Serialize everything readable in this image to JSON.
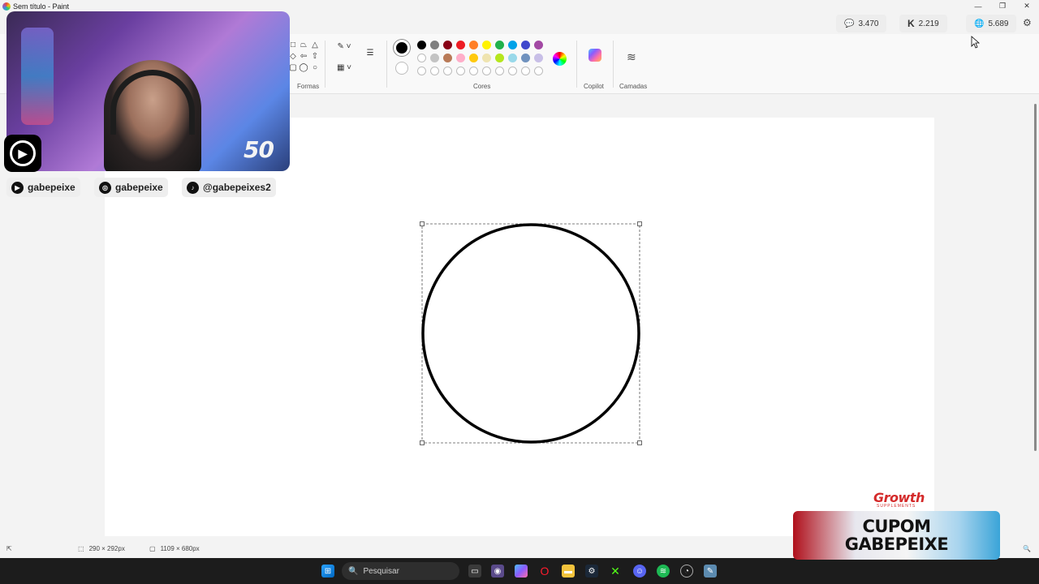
{
  "window": {
    "title": "Sem título - Paint"
  },
  "window_controls": {
    "minimize": "—",
    "maximize": "❐",
    "close": "✕"
  },
  "stats": [
    {
      "icon": "chat-icon",
      "value": "3.470"
    },
    {
      "icon": "kick-icon",
      "value": "2.219"
    },
    {
      "icon": "globe-icon",
      "value": "5.689"
    }
  ],
  "ribbon": {
    "shapes_label": "Formas",
    "colors_label": "Cores",
    "copilot_label": "Copilot",
    "layers_label": "Camadas",
    "palette_row1": [
      "#000000",
      "#7f7f7f",
      "#880015",
      "#ed1c24",
      "#ff7f27",
      "#fff200",
      "#22b14c",
      "#00a2e8",
      "#3f48cc",
      "#a349a4"
    ],
    "palette_row2": [
      "#ffffff",
      "#c3c3c3",
      "#b97a57",
      "#ffaec9",
      "#ffc90e",
      "#efe4b0",
      "#b5e61d",
      "#99d9ea",
      "#7092be",
      "#c8bfe7"
    ]
  },
  "statusbar": {
    "selection_size": "290 × 292px",
    "canvas_size": "1109 × 680px"
  },
  "taskbar": {
    "search_placeholder": "Pesquisar"
  },
  "overlay": {
    "viewer_counter": "50",
    "socials": [
      {
        "icon": "youtube-icon",
        "handle": "gabepeixe"
      },
      {
        "icon": "instagram-icon",
        "handle": "gabepeixe"
      },
      {
        "icon": "tiktok-icon",
        "handle": "@gabepeixes2"
      }
    ],
    "sponsor_logo": "Growth",
    "sponsor_sub": "SUPPLEMENTS",
    "coupon_line1": "CUPOM",
    "coupon_line2": "GABEPEIXE"
  }
}
